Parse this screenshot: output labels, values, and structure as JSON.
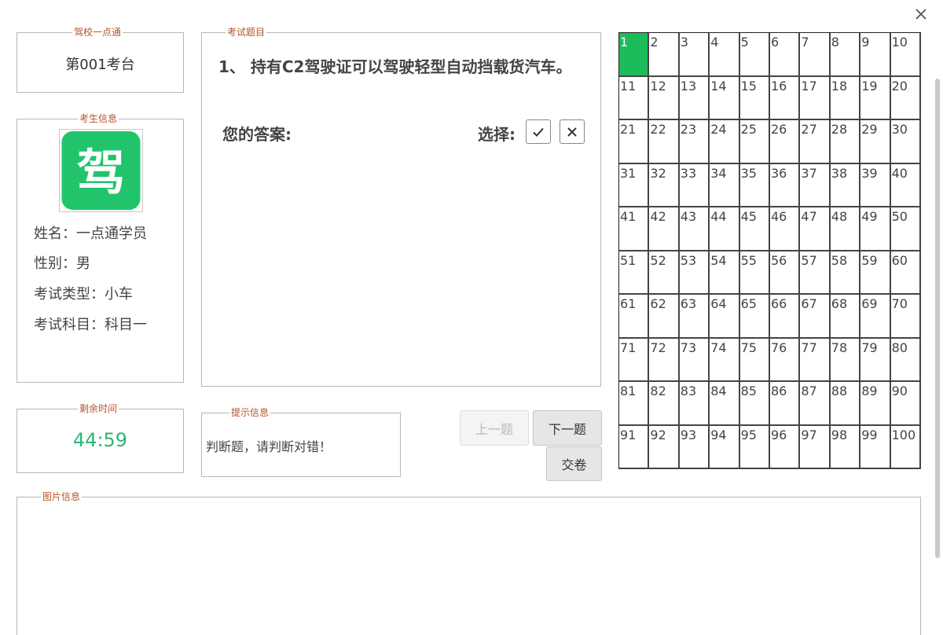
{
  "window": {
    "close_icon": "close-icon"
  },
  "school_panel": {
    "legend": "驾校一点通",
    "console": "第001考台"
  },
  "student_panel": {
    "legend": "考生信息",
    "avatar_icon": "jia-logo-icon",
    "avatar_char": "驾",
    "name": "姓名：一点通学员",
    "gender": "性别：男",
    "exam_type": "考试类型：小车",
    "exam_subject": "考试科目：科目一"
  },
  "timer_panel": {
    "legend": "剩余时间",
    "remaining": "44:59"
  },
  "question_panel": {
    "legend": "考试题目",
    "question": "1、 持有C2驾驶证可以驾驶轻型自动挡载货汽车。",
    "answer_label": "您的答案:",
    "choose_label": "选择:",
    "true_icon": "check-icon",
    "false_icon": "cross-icon"
  },
  "hint_panel": {
    "legend": "提示信息",
    "text": "判断题，请判断对错！"
  },
  "nav": {
    "prev": "上一题",
    "next": "下一题",
    "submit": "交卷"
  },
  "grid": {
    "total": 100,
    "current": 1
  },
  "image_panel": {
    "legend": "图片信息"
  },
  "colors": {
    "accent_green": "#1ebb5a",
    "timer_green": "#2bb673",
    "legend_brown": "#b5532b"
  }
}
